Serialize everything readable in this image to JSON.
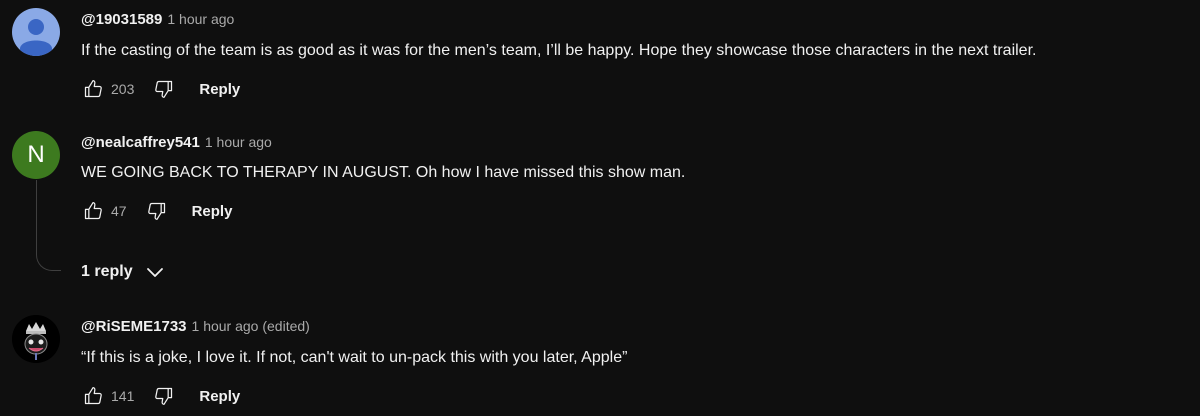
{
  "comments": [
    {
      "author": "@19031589",
      "time": "1 hour ago",
      "text": "If the casting of the team is as good as it was for the men’s team, I’ll be happy. Hope they showcase those characters in the next trailer.",
      "likes": "203",
      "reply_label": "Reply",
      "avatar_type": "default-person-icon"
    },
    {
      "author": "@nealcaffrey541",
      "time": "1 hour ago",
      "text": "WE GOING BACK TO THERAPY IN AUGUST. Oh how I have missed this show man.",
      "likes": "47",
      "reply_label": "Reply",
      "avatar_letter": "N",
      "replies_toggle": "1 reply"
    },
    {
      "author": "@RiSEME1733",
      "time": "1 hour ago (edited)",
      "text": "“If this is a joke, I love it. If not, can't wait to un-pack this with you later, Apple”",
      "likes": "141",
      "reply_label": "Reply",
      "avatar_type": "custom-image"
    }
  ],
  "colors": {
    "background": "#0f0f0f",
    "text": "#f1f1f1",
    "secondary": "#aaaaaa",
    "avatar_n": "#3d7a1f",
    "avatar_default": "#8aa9e6"
  }
}
